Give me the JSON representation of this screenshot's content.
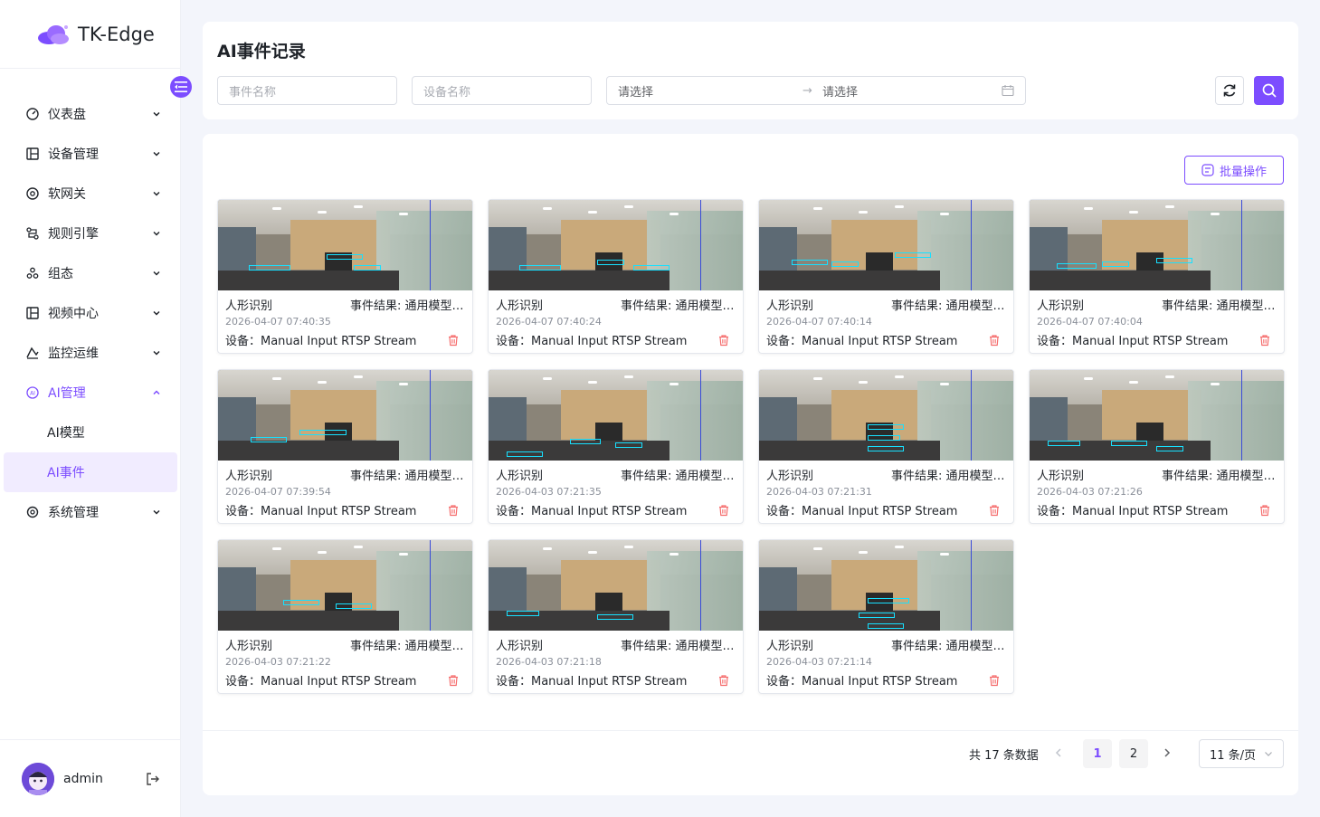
{
  "app": {
    "name": "TK-Edge"
  },
  "theme": {
    "accent": "#7c4dff",
    "danger": "#f56c6c",
    "detection": "#17e0ff"
  },
  "sidebar": {
    "items": [
      {
        "label": "仪表盘",
        "icon": "dashboard-icon",
        "expanded": false
      },
      {
        "label": "设备管理",
        "icon": "device-icon",
        "expanded": false
      },
      {
        "label": "软网关",
        "icon": "gateway-icon",
        "expanded": false
      },
      {
        "label": "规则引擎",
        "icon": "rule-engine-icon",
        "expanded": false
      },
      {
        "label": "组态",
        "icon": "configuration-icon",
        "expanded": false
      },
      {
        "label": "视频中心",
        "icon": "video-icon",
        "expanded": false
      },
      {
        "label": "监控运维",
        "icon": "monitor-icon",
        "expanded": false
      },
      {
        "label": "AI管理",
        "icon": "ai-icon",
        "expanded": true,
        "children": [
          {
            "label": "AI模型",
            "active": false
          },
          {
            "label": "AI事件",
            "active": true
          }
        ]
      },
      {
        "label": "系统管理",
        "icon": "settings-icon",
        "expanded": false
      }
    ],
    "user": {
      "name": "admin"
    }
  },
  "header": {
    "title": "AI事件记录"
  },
  "filters": {
    "event_name_placeholder": "事件名称",
    "device_name_placeholder": "设备名称",
    "date_start_placeholder": "请选择",
    "date_end_placeholder": "请选择",
    "range_separator": "→"
  },
  "toolbar": {
    "batch_label": "批量操作"
  },
  "events": [
    {
      "type": "人形识别",
      "result": "事件结果: 通用模型检测到目标",
      "time": "2026-04-07 07:40:35",
      "device": "设备：Manual Input RTSP Stream"
    },
    {
      "type": "人形识别",
      "result": "事件结果: 通用模型检测到目标",
      "time": "2026-04-07 07:40:24",
      "device": "设备：Manual Input RTSP Stream"
    },
    {
      "type": "人形识别",
      "result": "事件结果: 通用模型检测到目标",
      "time": "2026-04-07 07:40:14",
      "device": "设备：Manual Input RTSP Stream"
    },
    {
      "type": "人形识别",
      "result": "事件结果: 通用模型检测到目标",
      "time": "2026-04-07 07:40:04",
      "device": "设备：Manual Input RTSP Stream"
    },
    {
      "type": "人形识别",
      "result": "事件结果: 通用模型检测到目标",
      "time": "2026-04-07 07:39:54",
      "device": "设备：Manual Input RTSP Stream"
    },
    {
      "type": "人形识别",
      "result": "事件结果: 通用模型检测到目标",
      "time": "2026-04-03 07:21:35",
      "device": "设备：Manual Input RTSP Stream"
    },
    {
      "type": "人形识别",
      "result": "事件结果: 通用模型检测到目标",
      "time": "2026-04-03 07:21:31",
      "device": "设备：Manual Input RTSP Stream"
    },
    {
      "type": "人形识别",
      "result": "事件结果: 通用模型检测到目标",
      "time": "2026-04-03 07:21:26",
      "device": "设备：Manual Input RTSP Stream"
    },
    {
      "type": "人形识别",
      "result": "事件结果: 通用模型检测到目标",
      "time": "2026-04-03 07:21:22",
      "device": "设备：Manual Input RTSP Stream"
    },
    {
      "type": "人形识别",
      "result": "事件结果: 通用模型检测到目标",
      "time": "2026-04-03 07:21:18",
      "device": "设备：Manual Input RTSP Stream"
    },
    {
      "type": "人形识别",
      "result": "事件结果: 通用模型检测到目标",
      "time": "2026-04-03 07:21:14",
      "device": "设备：Manual Input RTSP Stream"
    }
  ],
  "pagination": {
    "total_text": "共 17 条数据",
    "pages": [
      "1",
      "2"
    ],
    "current": "1",
    "page_size": "11 条/页"
  }
}
